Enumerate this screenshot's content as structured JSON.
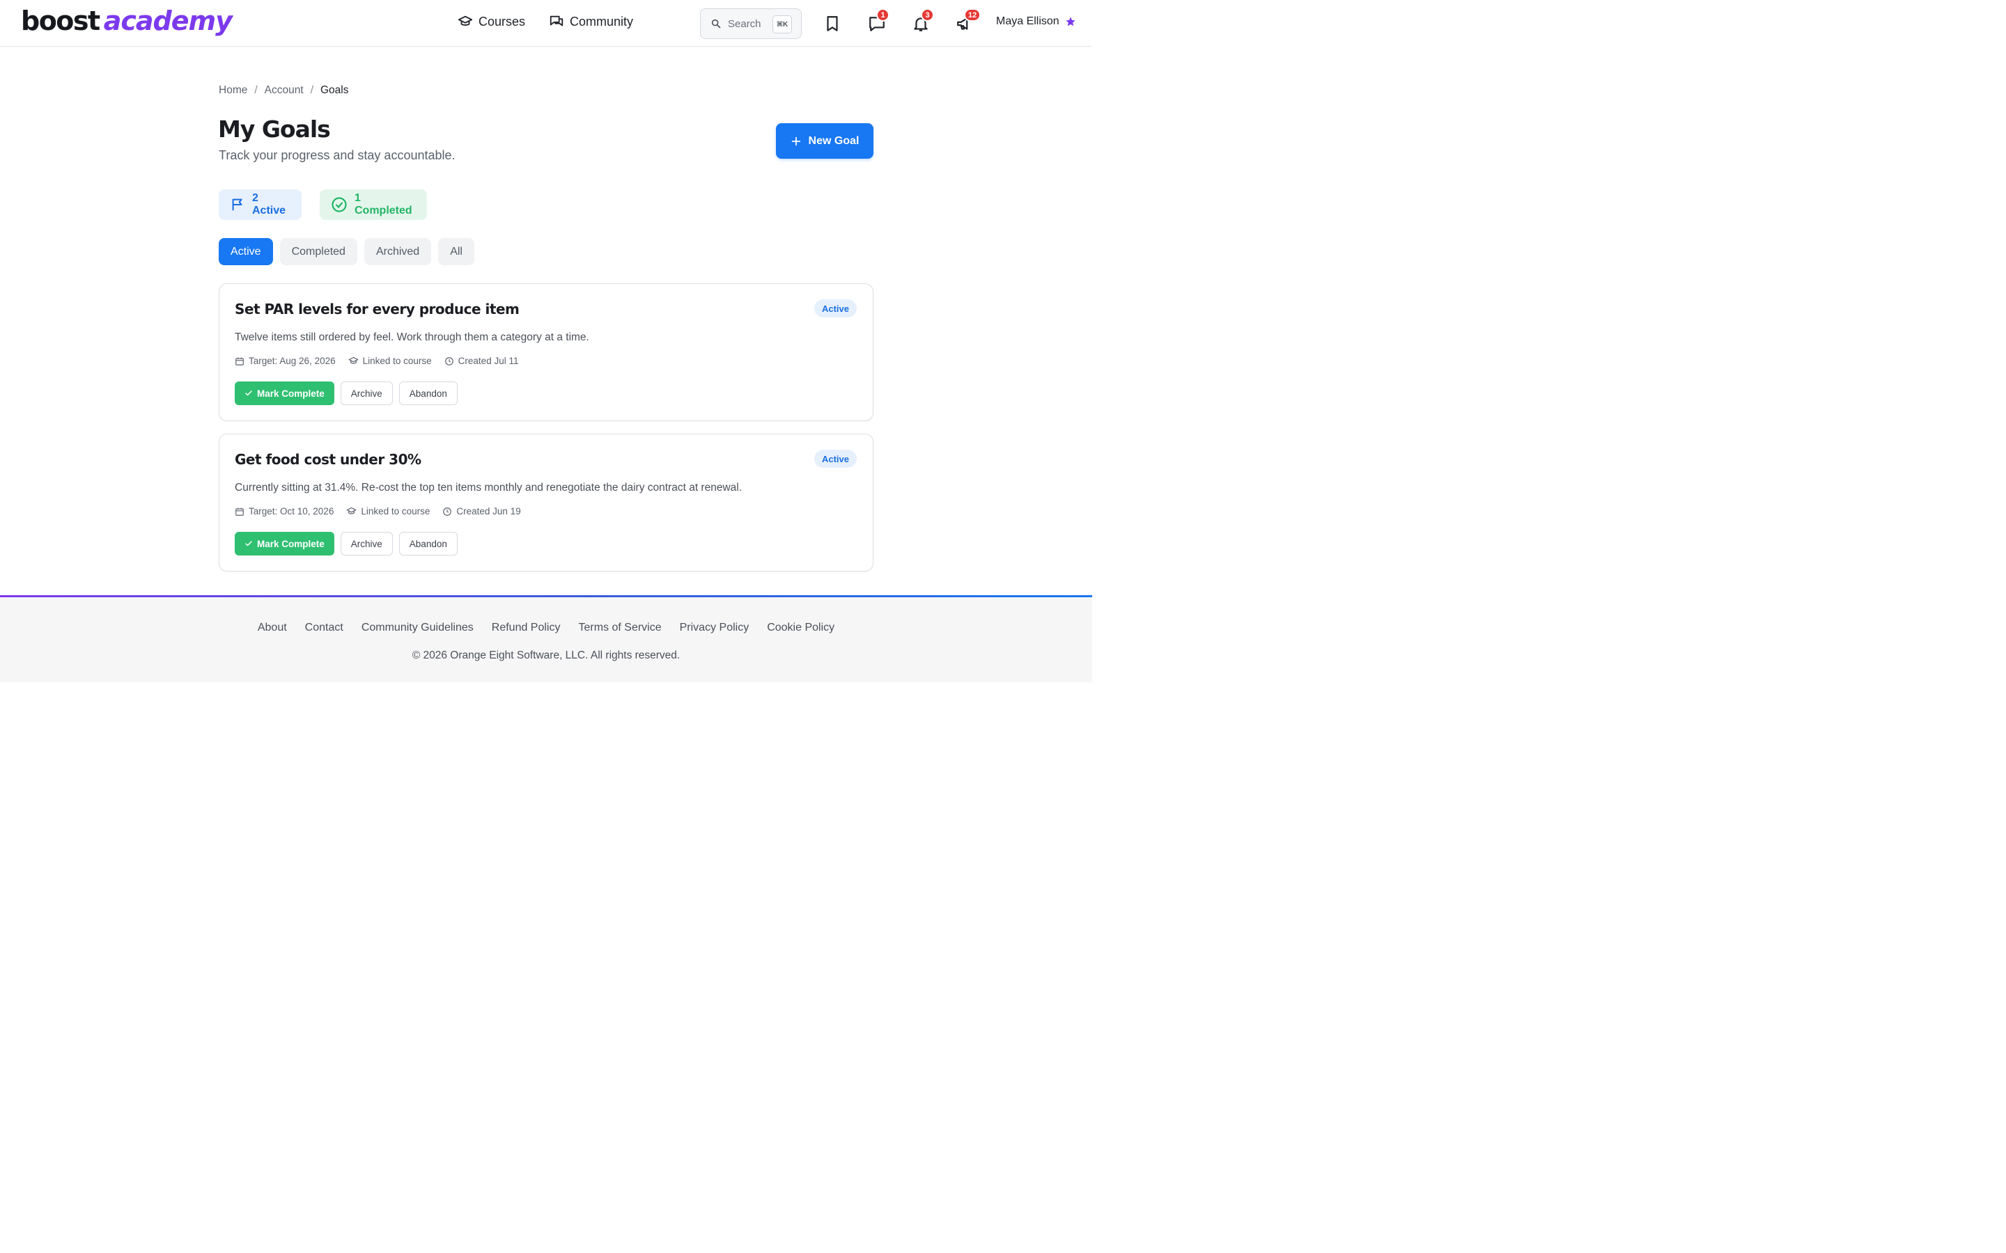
{
  "brand": {
    "part1": "boost",
    "part2": "academy"
  },
  "nav": {
    "courses": "Courses",
    "community": "Community"
  },
  "search": {
    "placeholder": "Search",
    "shortcut": "⌘K"
  },
  "header_icons": {
    "bookmark": "bookmark-icon",
    "messages": {
      "icon": "chat-icon",
      "count": "1"
    },
    "notifications": {
      "icon": "bell-icon",
      "count": "3"
    },
    "announcements": {
      "icon": "megaphone-icon",
      "count": "12"
    }
  },
  "user": {
    "name": "Maya Ellison"
  },
  "breadcrumb": {
    "home": "Home",
    "sep": "/",
    "account": "Account",
    "current": "Goals"
  },
  "page": {
    "title": "My Goals",
    "subtitle": "Track your progress and stay accountable.",
    "new_goal": "New Goal"
  },
  "stats": {
    "active": "2 Active",
    "completed": "1 Completed"
  },
  "tabs": [
    "Active",
    "Completed",
    "Archived",
    "All"
  ],
  "goals": [
    {
      "title": "Set PAR levels for every produce item",
      "status": "Active",
      "description": "Twelve items still ordered by feel. Work through them a category at a time.",
      "target": "Target: Aug 26, 2026",
      "linked": "Linked to course",
      "created": "Created Jul 11"
    },
    {
      "title": "Get food cost under 30%",
      "status": "Active",
      "description": "Currently sitting at 31.4%. Re-cost the top ten items monthly and renegotiate the dairy contract at renewal.",
      "target": "Target: Oct 10, 2026",
      "linked": "Linked to course",
      "created": "Created Jun 19"
    }
  ],
  "goal_actions": {
    "complete": "Mark Complete",
    "archive": "Archive",
    "abandon": "Abandon"
  },
  "footer": {
    "links": [
      "About",
      "Contact",
      "Community Guidelines",
      "Refund Policy",
      "Terms of Service",
      "Privacy Policy",
      "Cookie Policy"
    ],
    "copyright": "© 2026 Orange Eight Software, LLC. All rights reserved."
  },
  "colors": {
    "primary": "#1877f2",
    "brand_purple": "#7c3aed",
    "success": "#2fbf71",
    "badge": "#e53935"
  }
}
